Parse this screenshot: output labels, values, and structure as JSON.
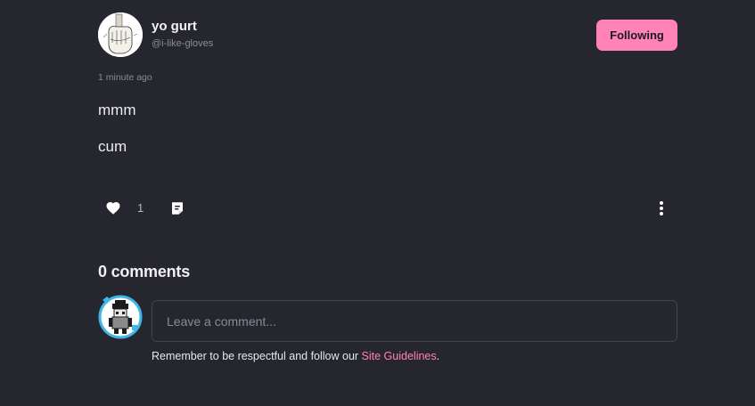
{
  "post": {
    "author": {
      "display_name": "yo gurt",
      "handle": "@i-like-gloves",
      "avatar": "glove-drawing-avatar"
    },
    "follow_button_label": "Following",
    "timestamp": "1 minute ago",
    "body_lines": [
      "mmm",
      "cum"
    ],
    "like_count": "1",
    "icons": {
      "like": "heart-icon",
      "reblog": "reblog-icon",
      "more": "more-vertical-icon"
    }
  },
  "comments": {
    "heading": "0 comments",
    "input_placeholder": "Leave a comment...",
    "guideline_prefix": "Remember to be respectful and follow our ",
    "guideline_link": "Site Guidelines",
    "guideline_suffix": "."
  },
  "colors": {
    "background": "#26262f",
    "accent_pink": "#ff83b9",
    "muted_text": "#8a8a96",
    "input_border": "#44444f"
  }
}
